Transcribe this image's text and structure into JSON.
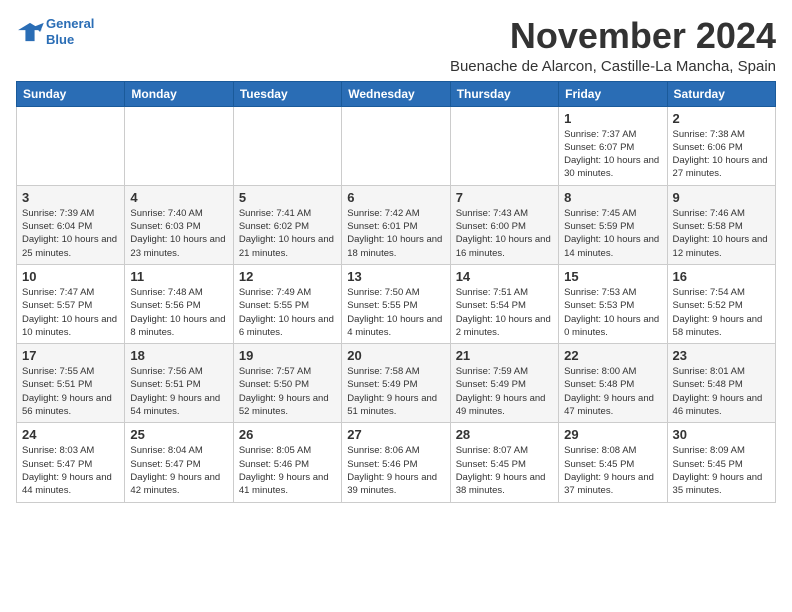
{
  "header": {
    "logo_line1": "General",
    "logo_line2": "Blue",
    "month_title": "November 2024",
    "subtitle": "Buenache de Alarcon, Castille-La Mancha, Spain"
  },
  "weekdays": [
    "Sunday",
    "Monday",
    "Tuesday",
    "Wednesday",
    "Thursday",
    "Friday",
    "Saturday"
  ],
  "weeks": [
    [
      {
        "day": "",
        "info": ""
      },
      {
        "day": "",
        "info": ""
      },
      {
        "day": "",
        "info": ""
      },
      {
        "day": "",
        "info": ""
      },
      {
        "day": "",
        "info": ""
      },
      {
        "day": "1",
        "info": "Sunrise: 7:37 AM\nSunset: 6:07 PM\nDaylight: 10 hours and 30 minutes."
      },
      {
        "day": "2",
        "info": "Sunrise: 7:38 AM\nSunset: 6:06 PM\nDaylight: 10 hours and 27 minutes."
      }
    ],
    [
      {
        "day": "3",
        "info": "Sunrise: 7:39 AM\nSunset: 6:04 PM\nDaylight: 10 hours and 25 minutes."
      },
      {
        "day": "4",
        "info": "Sunrise: 7:40 AM\nSunset: 6:03 PM\nDaylight: 10 hours and 23 minutes."
      },
      {
        "day": "5",
        "info": "Sunrise: 7:41 AM\nSunset: 6:02 PM\nDaylight: 10 hours and 21 minutes."
      },
      {
        "day": "6",
        "info": "Sunrise: 7:42 AM\nSunset: 6:01 PM\nDaylight: 10 hours and 18 minutes."
      },
      {
        "day": "7",
        "info": "Sunrise: 7:43 AM\nSunset: 6:00 PM\nDaylight: 10 hours and 16 minutes."
      },
      {
        "day": "8",
        "info": "Sunrise: 7:45 AM\nSunset: 5:59 PM\nDaylight: 10 hours and 14 minutes."
      },
      {
        "day": "9",
        "info": "Sunrise: 7:46 AM\nSunset: 5:58 PM\nDaylight: 10 hours and 12 minutes."
      }
    ],
    [
      {
        "day": "10",
        "info": "Sunrise: 7:47 AM\nSunset: 5:57 PM\nDaylight: 10 hours and 10 minutes."
      },
      {
        "day": "11",
        "info": "Sunrise: 7:48 AM\nSunset: 5:56 PM\nDaylight: 10 hours and 8 minutes."
      },
      {
        "day": "12",
        "info": "Sunrise: 7:49 AM\nSunset: 5:55 PM\nDaylight: 10 hours and 6 minutes."
      },
      {
        "day": "13",
        "info": "Sunrise: 7:50 AM\nSunset: 5:55 PM\nDaylight: 10 hours and 4 minutes."
      },
      {
        "day": "14",
        "info": "Sunrise: 7:51 AM\nSunset: 5:54 PM\nDaylight: 10 hours and 2 minutes."
      },
      {
        "day": "15",
        "info": "Sunrise: 7:53 AM\nSunset: 5:53 PM\nDaylight: 10 hours and 0 minutes."
      },
      {
        "day": "16",
        "info": "Sunrise: 7:54 AM\nSunset: 5:52 PM\nDaylight: 9 hours and 58 minutes."
      }
    ],
    [
      {
        "day": "17",
        "info": "Sunrise: 7:55 AM\nSunset: 5:51 PM\nDaylight: 9 hours and 56 minutes."
      },
      {
        "day": "18",
        "info": "Sunrise: 7:56 AM\nSunset: 5:51 PM\nDaylight: 9 hours and 54 minutes."
      },
      {
        "day": "19",
        "info": "Sunrise: 7:57 AM\nSunset: 5:50 PM\nDaylight: 9 hours and 52 minutes."
      },
      {
        "day": "20",
        "info": "Sunrise: 7:58 AM\nSunset: 5:49 PM\nDaylight: 9 hours and 51 minutes."
      },
      {
        "day": "21",
        "info": "Sunrise: 7:59 AM\nSunset: 5:49 PM\nDaylight: 9 hours and 49 minutes."
      },
      {
        "day": "22",
        "info": "Sunrise: 8:00 AM\nSunset: 5:48 PM\nDaylight: 9 hours and 47 minutes."
      },
      {
        "day": "23",
        "info": "Sunrise: 8:01 AM\nSunset: 5:48 PM\nDaylight: 9 hours and 46 minutes."
      }
    ],
    [
      {
        "day": "24",
        "info": "Sunrise: 8:03 AM\nSunset: 5:47 PM\nDaylight: 9 hours and 44 minutes."
      },
      {
        "day": "25",
        "info": "Sunrise: 8:04 AM\nSunset: 5:47 PM\nDaylight: 9 hours and 42 minutes."
      },
      {
        "day": "26",
        "info": "Sunrise: 8:05 AM\nSunset: 5:46 PM\nDaylight: 9 hours and 41 minutes."
      },
      {
        "day": "27",
        "info": "Sunrise: 8:06 AM\nSunset: 5:46 PM\nDaylight: 9 hours and 39 minutes."
      },
      {
        "day": "28",
        "info": "Sunrise: 8:07 AM\nSunset: 5:45 PM\nDaylight: 9 hours and 38 minutes."
      },
      {
        "day": "29",
        "info": "Sunrise: 8:08 AM\nSunset: 5:45 PM\nDaylight: 9 hours and 37 minutes."
      },
      {
        "day": "30",
        "info": "Sunrise: 8:09 AM\nSunset: 5:45 PM\nDaylight: 9 hours and 35 minutes."
      }
    ]
  ]
}
